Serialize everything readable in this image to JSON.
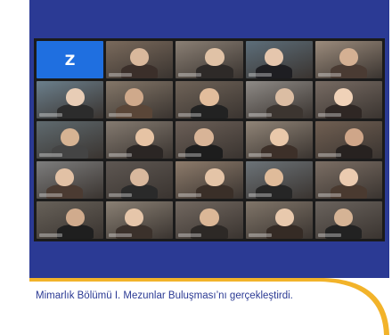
{
  "caption": {
    "text": "Mimarlık Bölümü I. Mezunlar Buluşması’nı gerçekleştirdi."
  },
  "zoom_tile": {
    "letter": "Z"
  },
  "colors": {
    "brand_blue": "#2b3a94",
    "accent_gold": "#f2b32a",
    "zoom_blue": "#1f6fe0"
  },
  "participants_grid": {
    "rows": 5,
    "columns": 5
  }
}
